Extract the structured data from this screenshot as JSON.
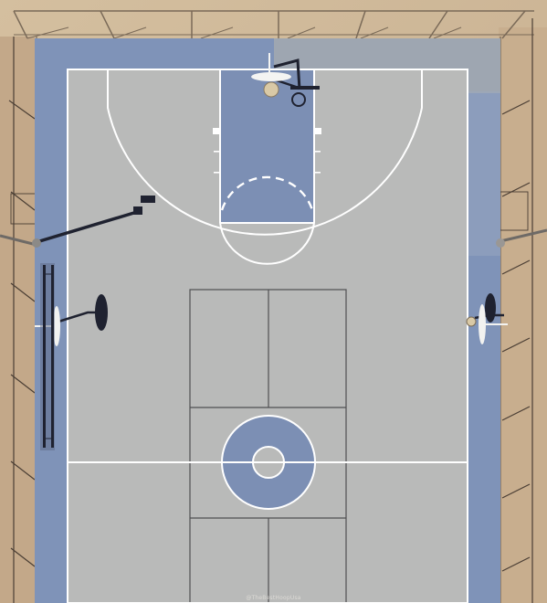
{
  "scene": {
    "subject": "basketball-court",
    "colors": {
      "dirt": "#cdb79c",
      "dirt_dark": "#b99d7c",
      "outer_court": "#7f93b8",
      "inner_court": "#b9bab9",
      "paint_key": "#7c8fb4",
      "line": "#ffffff",
      "pickleball_line": "#4f4f52",
      "shadow": "#1f2230"
    }
  },
  "watermark": {
    "text": "@TheBestHoopUsa"
  }
}
